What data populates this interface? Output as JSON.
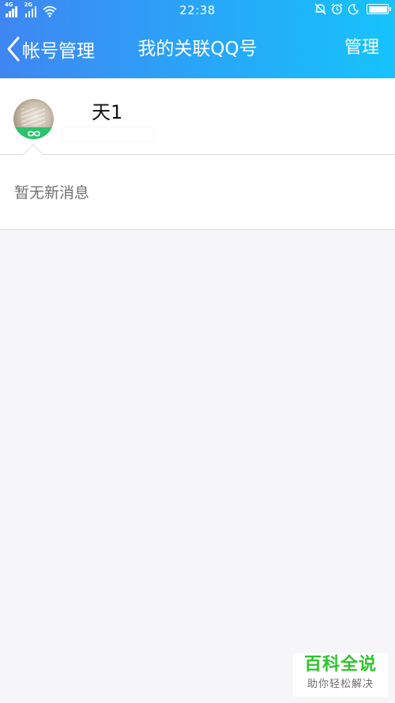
{
  "status_bar": {
    "sim1_network": "4G",
    "sim2_network": "2G",
    "time": "22:38",
    "icons": [
      "sim1-signal-icon",
      "sim2-signal-icon",
      "wifi-icon",
      "bell-icon",
      "alarm-icon",
      "moon-icon",
      "battery-icon"
    ]
  },
  "nav": {
    "back_label": "帐号管理",
    "title": "我的关联QQ号",
    "manage_label": "管理"
  },
  "account": {
    "name_visible": "天1"
  },
  "messages": {
    "empty_text": "暂无新消息"
  },
  "watermark": {
    "main": "百科全说",
    "sub": "助你轻松解决"
  },
  "colors": {
    "header_start": "#3f86f2",
    "header_end": "#16c3fb",
    "badge_green": "#2bc36e",
    "watermark_green": "#2ec52c",
    "background": "#f6f6f8"
  }
}
